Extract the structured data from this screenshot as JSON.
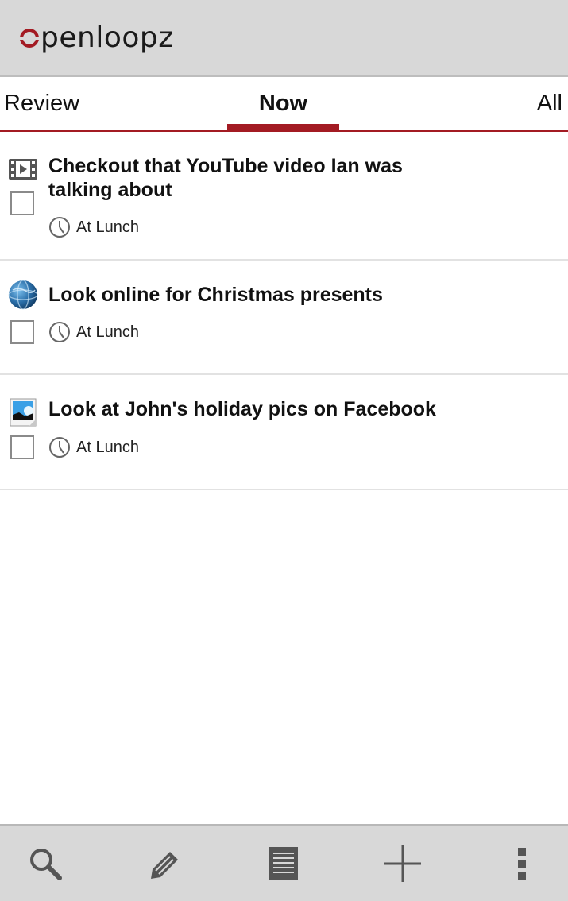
{
  "app": {
    "logo_text": "penloopz"
  },
  "tabs": [
    {
      "label": "Review"
    },
    {
      "label": "Now"
    },
    {
      "label": "All"
    }
  ],
  "items": [
    {
      "icon": "video-icon",
      "title": "Checkout that YouTube video Ian was talking about",
      "context": "At Lunch",
      "checked": false
    },
    {
      "icon": "globe-icon",
      "title": "Look online for Christmas presents",
      "context": "At Lunch",
      "checked": false
    },
    {
      "icon": "picture-icon",
      "title": "Look at John's holiday pics on Facebook",
      "context": "At Lunch",
      "checked": false
    }
  ],
  "bottom_bar": [
    "search-icon",
    "edit-icon",
    "list-icon",
    "add-icon",
    "overflow-menu-icon"
  ],
  "colors": {
    "accent": "#a31b23",
    "bar_bg": "#d8d8d8"
  }
}
